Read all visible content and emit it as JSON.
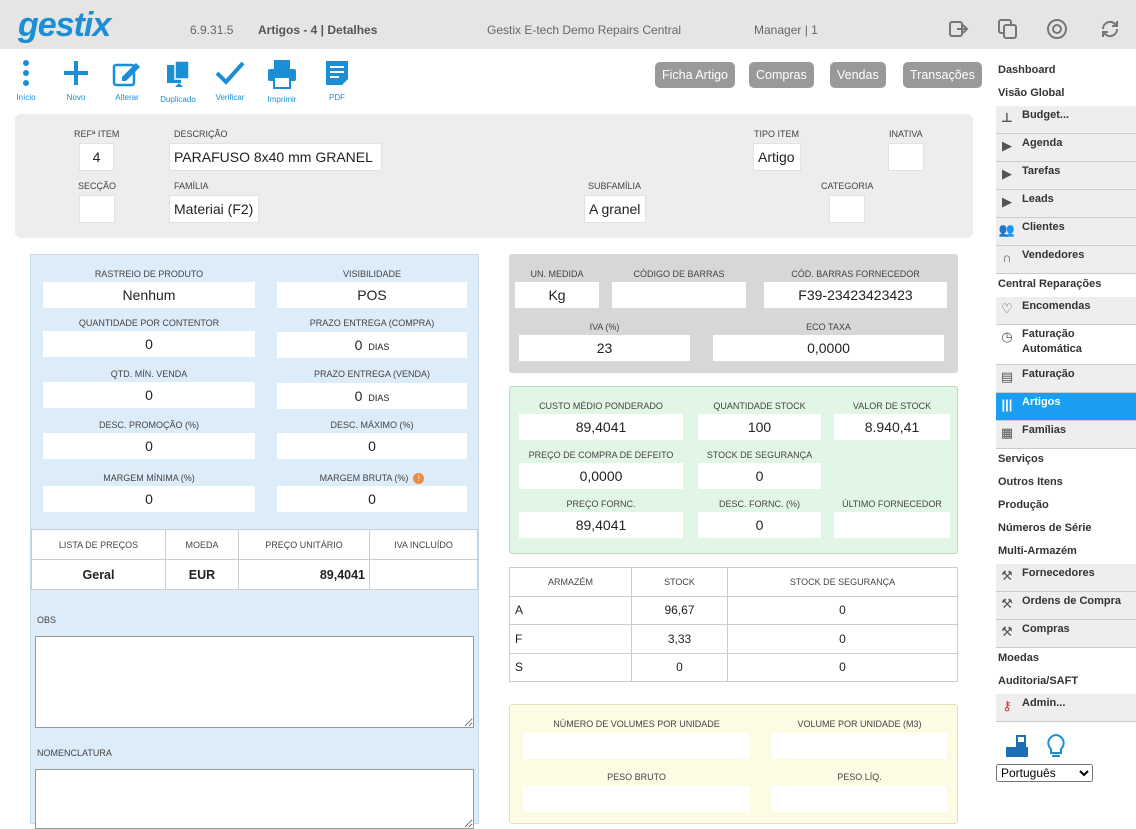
{
  "header": {
    "logo": "gestix",
    "version": "6.9.31.5",
    "page": "Artigos - 4 | Detalhes",
    "company": "Gestix E-tech Demo Repairs Central",
    "user": "Manager | 1"
  },
  "toolbar": {
    "inicio": "Início",
    "novo": "Novo",
    "alterar": "Alterar",
    "duplicado": "Duplicado",
    "verificar": "Verificar",
    "imprimir": "Imprimir",
    "pdf": "PDF",
    "ficha": "Ficha Artigo",
    "compras": "Compras",
    "vendas": "Vendas",
    "transacoes": "Transações"
  },
  "item": {
    "ref_label": "REFª ITEM",
    "ref": "4",
    "desc_label": "DESCRIÇÃO",
    "desc": "PARAFUSO 8x40 mm GRANEL",
    "tipo_label": "TIPO ITEM",
    "tipo": "Artigo",
    "inativa_label": "INATIVA",
    "inativa": "",
    "seccao_label": "SECÇÃO",
    "seccao": "",
    "familia_label": "FAMÍLIA",
    "familia": "Materiai (F2)",
    "subfamilia_label": "SUBFAMÍLIA",
    "subfamilia": "A granel",
    "categoria_label": "CATEGORIA",
    "categoria": ""
  },
  "blue": {
    "rastreio_label": "RASTREIO DE PRODUTO",
    "rastreio": "Nenhum",
    "visibilidade_label": "VISIBILIDADE",
    "visibilidade": "POS",
    "qtd_contentor_label": "QUANTIDADE POR CONTENTOR",
    "qtd_contentor": "0",
    "prazo_compra_label": "PRAZO ENTREGA (COMPRA)",
    "prazo_compra": "0",
    "dias": "DIAS",
    "qtd_min_label": "QTD. MÍN. VENDA",
    "qtd_min": "0",
    "prazo_venda_label": "PRAZO ENTREGA (VENDA)",
    "prazo_venda": "0",
    "desc_promo_label": "DESC. PROMOÇÃO (%)",
    "desc_promo": "0",
    "desc_max_label": "DESC. MÁXIMO (%)",
    "desc_max": "0",
    "margem_min_label": "MARGEM MÍNIMA (%)",
    "margem_min": "0",
    "margem_bruta_label": "MARGEM BRUTA (%)",
    "margem_bruta": "0",
    "obs_label": "OBS",
    "nomenclatura_label": "NOMENCLATURA"
  },
  "price_list": {
    "headers": [
      "LISTA DE PREÇOS",
      "MOEDA",
      "PREÇO UNITÁRIO",
      "IVA INCLUÍDO"
    ],
    "row": [
      "Geral",
      "EUR",
      "89,4041",
      ""
    ]
  },
  "grey": {
    "un_label": "UN. MEDIDA",
    "un": "Kg",
    "barras_label": "CÓDIGO DE BARRAS",
    "barras": "",
    "barras_forn_label": "CÓD. BARRAS FORNECEDOR",
    "barras_forn": "F39-23423423423",
    "iva_label": "IVA (%)",
    "iva": "23",
    "eco_label": "ECO TAXA",
    "eco": "0,0000"
  },
  "green": {
    "custo_label": "CUSTO MÉDIO PONDERADO",
    "custo": "89,4041",
    "qtd_stock_label": "QUANTIDADE STOCK",
    "qtd_stock": "100",
    "valor_stock_label": "VALOR DE STOCK",
    "valor_stock": "8.940,41",
    "preco_compra_label": "PREÇO DE COMPRA DE DEFEITO",
    "preco_compra": "0,0000",
    "stock_seg_label": "STOCK DE SEGURANÇA",
    "stock_seg": "0",
    "preco_forn_label": "PREÇO FORNC.",
    "preco_forn": "89,4041",
    "desc_forn_label": "DESC. FORNC. (%)",
    "desc_forn": "0",
    "ultimo_forn_label": "ÚLTIMO FORNECEDOR",
    "ultimo_forn": ""
  },
  "warehouse": {
    "headers": [
      "ARMAZÉM",
      "STOCK",
      "STOCK DE SEGURANÇA"
    ],
    "rows": [
      [
        "A",
        "96,67",
        "0"
      ],
      [
        "F",
        "3,33",
        "0"
      ],
      [
        "S",
        "0",
        "0"
      ]
    ]
  },
  "yellow": {
    "volumes_label": "NÚMERO DE VOLUMES POR UNIDADE",
    "volume_label": "VOLUME POR UNIDADE (m3)",
    "peso_bruto_label": "PESO BRUTO",
    "peso_liq_label": "PESO LÍQ."
  },
  "sidebar": [
    "Dashboard",
    "Visão Global",
    "Budget...",
    "Agenda",
    "Tarefas",
    "Leads",
    "Clientes",
    "Vendedores",
    "Central Reparações",
    "Encomendas",
    "Faturação Automática",
    "Faturação",
    "Artigos",
    "Famílias",
    "Serviços",
    "Outros Itens",
    "Produção",
    "Números de Série",
    "Multi-Armazém",
    "Fornecedores",
    "Ordens de Compra",
    "Compras",
    "Moedas",
    "Auditoria/SAFT",
    "Admin..."
  ],
  "language": "Português",
  "colors": {
    "accent": "#1a8fd6",
    "active": "#1a9ff0"
  }
}
